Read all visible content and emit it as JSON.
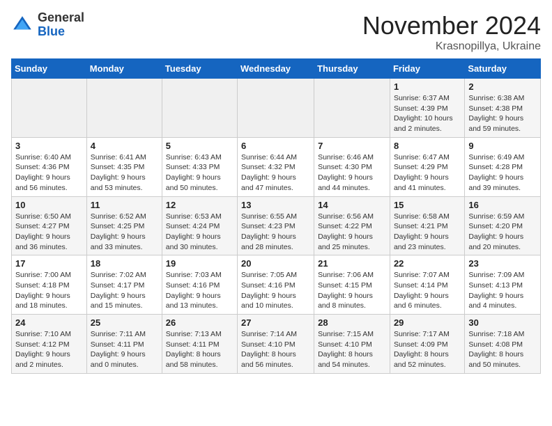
{
  "logo": {
    "general": "General",
    "blue": "Blue"
  },
  "title": "November 2024",
  "location": "Krasnopillya, Ukraine",
  "weekdays": [
    "Sunday",
    "Monday",
    "Tuesday",
    "Wednesday",
    "Thursday",
    "Friday",
    "Saturday"
  ],
  "weeks": [
    [
      {
        "day": "",
        "info": ""
      },
      {
        "day": "",
        "info": ""
      },
      {
        "day": "",
        "info": ""
      },
      {
        "day": "",
        "info": ""
      },
      {
        "day": "",
        "info": ""
      },
      {
        "day": "1",
        "info": "Sunrise: 6:37 AM\nSunset: 4:39 PM\nDaylight: 10 hours and 2 minutes."
      },
      {
        "day": "2",
        "info": "Sunrise: 6:38 AM\nSunset: 4:38 PM\nDaylight: 9 hours and 59 minutes."
      }
    ],
    [
      {
        "day": "3",
        "info": "Sunrise: 6:40 AM\nSunset: 4:36 PM\nDaylight: 9 hours and 56 minutes."
      },
      {
        "day": "4",
        "info": "Sunrise: 6:41 AM\nSunset: 4:35 PM\nDaylight: 9 hours and 53 minutes."
      },
      {
        "day": "5",
        "info": "Sunrise: 6:43 AM\nSunset: 4:33 PM\nDaylight: 9 hours and 50 minutes."
      },
      {
        "day": "6",
        "info": "Sunrise: 6:44 AM\nSunset: 4:32 PM\nDaylight: 9 hours and 47 minutes."
      },
      {
        "day": "7",
        "info": "Sunrise: 6:46 AM\nSunset: 4:30 PM\nDaylight: 9 hours and 44 minutes."
      },
      {
        "day": "8",
        "info": "Sunrise: 6:47 AM\nSunset: 4:29 PM\nDaylight: 9 hours and 41 minutes."
      },
      {
        "day": "9",
        "info": "Sunrise: 6:49 AM\nSunset: 4:28 PM\nDaylight: 9 hours and 39 minutes."
      }
    ],
    [
      {
        "day": "10",
        "info": "Sunrise: 6:50 AM\nSunset: 4:27 PM\nDaylight: 9 hours and 36 minutes."
      },
      {
        "day": "11",
        "info": "Sunrise: 6:52 AM\nSunset: 4:25 PM\nDaylight: 9 hours and 33 minutes."
      },
      {
        "day": "12",
        "info": "Sunrise: 6:53 AM\nSunset: 4:24 PM\nDaylight: 9 hours and 30 minutes."
      },
      {
        "day": "13",
        "info": "Sunrise: 6:55 AM\nSunset: 4:23 PM\nDaylight: 9 hours and 28 minutes."
      },
      {
        "day": "14",
        "info": "Sunrise: 6:56 AM\nSunset: 4:22 PM\nDaylight: 9 hours and 25 minutes."
      },
      {
        "day": "15",
        "info": "Sunrise: 6:58 AM\nSunset: 4:21 PM\nDaylight: 9 hours and 23 minutes."
      },
      {
        "day": "16",
        "info": "Sunrise: 6:59 AM\nSunset: 4:20 PM\nDaylight: 9 hours and 20 minutes."
      }
    ],
    [
      {
        "day": "17",
        "info": "Sunrise: 7:00 AM\nSunset: 4:18 PM\nDaylight: 9 hours and 18 minutes."
      },
      {
        "day": "18",
        "info": "Sunrise: 7:02 AM\nSunset: 4:17 PM\nDaylight: 9 hours and 15 minutes."
      },
      {
        "day": "19",
        "info": "Sunrise: 7:03 AM\nSunset: 4:16 PM\nDaylight: 9 hours and 13 minutes."
      },
      {
        "day": "20",
        "info": "Sunrise: 7:05 AM\nSunset: 4:16 PM\nDaylight: 9 hours and 10 minutes."
      },
      {
        "day": "21",
        "info": "Sunrise: 7:06 AM\nSunset: 4:15 PM\nDaylight: 9 hours and 8 minutes."
      },
      {
        "day": "22",
        "info": "Sunrise: 7:07 AM\nSunset: 4:14 PM\nDaylight: 9 hours and 6 minutes."
      },
      {
        "day": "23",
        "info": "Sunrise: 7:09 AM\nSunset: 4:13 PM\nDaylight: 9 hours and 4 minutes."
      }
    ],
    [
      {
        "day": "24",
        "info": "Sunrise: 7:10 AM\nSunset: 4:12 PM\nDaylight: 9 hours and 2 minutes."
      },
      {
        "day": "25",
        "info": "Sunrise: 7:11 AM\nSunset: 4:11 PM\nDaylight: 9 hours and 0 minutes."
      },
      {
        "day": "26",
        "info": "Sunrise: 7:13 AM\nSunset: 4:11 PM\nDaylight: 8 hours and 58 minutes."
      },
      {
        "day": "27",
        "info": "Sunrise: 7:14 AM\nSunset: 4:10 PM\nDaylight: 8 hours and 56 minutes."
      },
      {
        "day": "28",
        "info": "Sunrise: 7:15 AM\nSunset: 4:10 PM\nDaylight: 8 hours and 54 minutes."
      },
      {
        "day": "29",
        "info": "Sunrise: 7:17 AM\nSunset: 4:09 PM\nDaylight: 8 hours and 52 minutes."
      },
      {
        "day": "30",
        "info": "Sunrise: 7:18 AM\nSunset: 4:08 PM\nDaylight: 8 hours and 50 minutes."
      }
    ]
  ]
}
